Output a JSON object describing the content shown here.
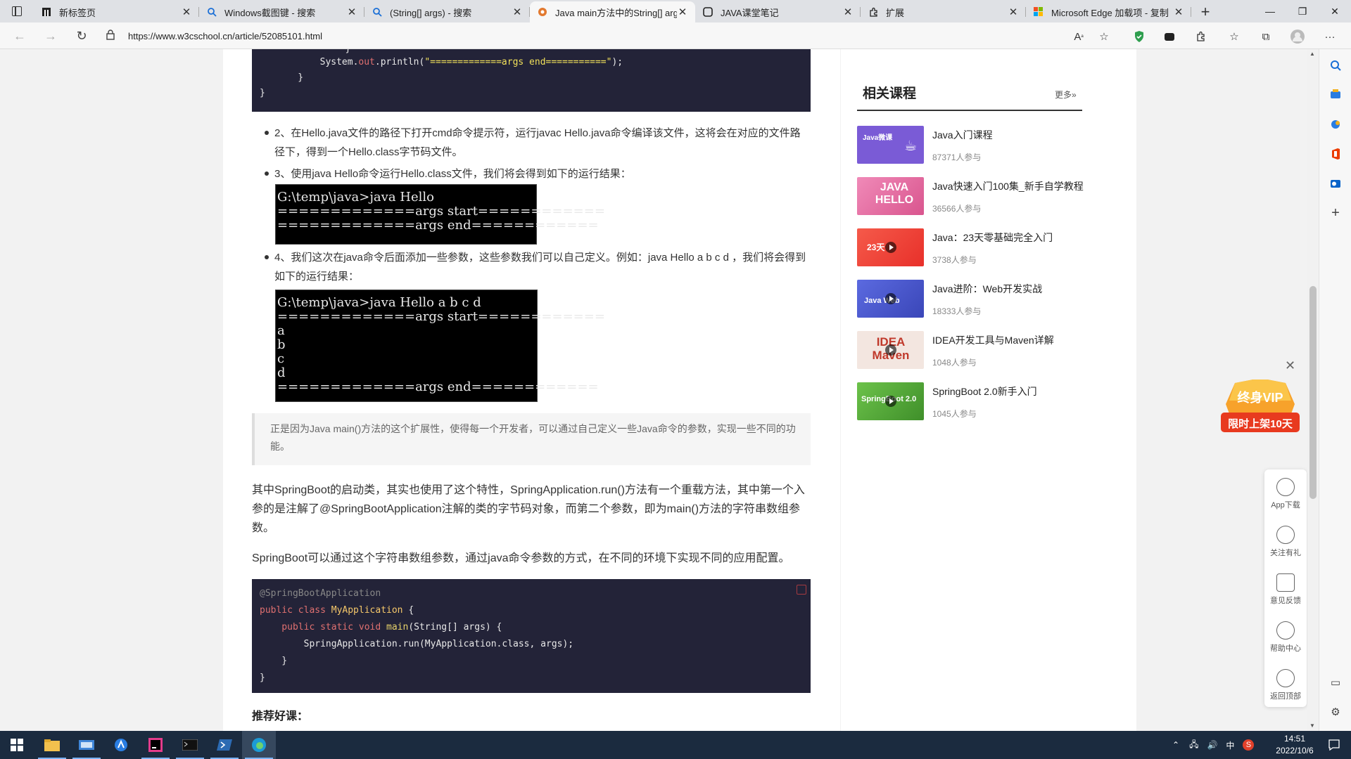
{
  "browser": {
    "tabs": [
      {
        "title": "新标签页",
        "icon": "page-icon"
      },
      {
        "title": "Windows截图键 - 搜索",
        "icon": "search-icon"
      },
      {
        "title": "(String[] args) - 搜索",
        "icon": "search-icon"
      },
      {
        "title": "Java main方法中的String[] args参数",
        "icon": "w3cschool-icon"
      },
      {
        "title": "JAVA课堂笔记",
        "icon": "note-icon"
      },
      {
        "title": "扩展",
        "icon": "extension-icon"
      },
      {
        "title": "Microsoft Edge 加载项 - 复制",
        "icon": "microsoft-icon"
      }
    ],
    "url": "https://www.w3cschool.cn/article/52085101.html"
  },
  "article": {
    "code_top": {
      "line_brace_pre": "        }",
      "line_println_pre": "        System.",
      "line_println_out": "out",
      "line_println_mid": ".println(",
      "line_println_str": "\"=============args end===========\"",
      "line_println_end": ");",
      "line_close1": "    }",
      "line_close2": "}"
    },
    "step2": "2、在Hello.java文件的路径下打开cmd命令提示符，运行javac Hello.java命令编译该文件，这将会在对应的文件路径下，得到一个Hello.class字节码文件。",
    "step3": "3、使用java Hello命令运行Hello.class文件，我们将会得到如下的运行结果：",
    "term1": [
      "G:\\temp\\java>java Hello",
      "=============args start============",
      "=============args end============"
    ],
    "step4": "4、我们这次在java命令后面添加一些参数，这些参数我们可以自己定义。例如：java Hello a b c d ，我们将会得到如下的运行结果：",
    "term2": [
      "G:\\temp\\java>java Hello a b c d",
      "=============args start============",
      "a",
      "b",
      "c",
      "d",
      "=============args end============"
    ],
    "quote": "正是因为Java main()方法的这个扩展性，使得每一个开发者，可以通过自己定义一些Java命令的参数，实现一些不同的功能。",
    "para1": "其中SpringBoot的启动类，其实也使用了这个特性，SpringApplication.run()方法有一个重载方法，其中第一个入参的是注解了@SpringBootApplication注解的类的字节码对象，而第二个参数，即为main()方法的字符串数组参数。",
    "para2": "SpringBoot可以通过这个字符串数组参数，通过java命令参数的方式，在不同的环境下实现不同的应用配置。",
    "code2": {
      "annotation": "@SpringBootApplication",
      "l2_kw": "public class ",
      "l2_cls": "MyApplication",
      "l2_rest": " {",
      "l3_kw": "    public static void ",
      "l3_fn": "main",
      "l3_rest": "(String[] args) {",
      "l4": "        SpringApplication.run(MyApplication.class, args);",
      "l5": "    }",
      "l6": "}"
    },
    "recommend_title": "推荐好课："
  },
  "sidebar": {
    "title": "相关课程",
    "more": "更多»",
    "courses": [
      {
        "title": "Java入门课程",
        "meta": "87371人参与",
        "thumb_text": "Java微课",
        "thumb_color": "#7a5bd6"
      },
      {
        "title": "Java快速入门100集_新手自学教程",
        "meta": "36566人参与",
        "thumb_text": "JAVA HELLO",
        "thumb_color": "#e9649a"
      },
      {
        "title": "Java：23天零基础完全入门",
        "meta": "3738人参与",
        "thumb_text": "23天",
        "thumb_color": "#f0463e"
      },
      {
        "title": "Java进阶：Web开发实战",
        "meta": "18333人参与",
        "thumb_text": "Java Web",
        "thumb_color": "#4b5bd0"
      },
      {
        "title": "IDEA开发工具与Maven详解",
        "meta": "1048人参与",
        "thumb_text": "IDEA Maven",
        "thumb_color": "#f1e2dc"
      },
      {
        "title": "SpringBoot 2.0新手入门",
        "meta": "1045人参与",
        "thumb_text": "SpringBoot 2.0",
        "thumb_color": "#5aaa3a"
      }
    ]
  },
  "vip": {
    "line1": "终身VIP",
    "line2": "限时上架10天"
  },
  "tools": [
    {
      "label": "App下载"
    },
    {
      "label": "关注有礼"
    },
    {
      "label": "意见反馈"
    },
    {
      "label": "帮助中心"
    },
    {
      "label": "返回顶部"
    }
  ],
  "taskbar": {
    "time": "14:51",
    "date": "2022/10/6",
    "ime": "中"
  }
}
